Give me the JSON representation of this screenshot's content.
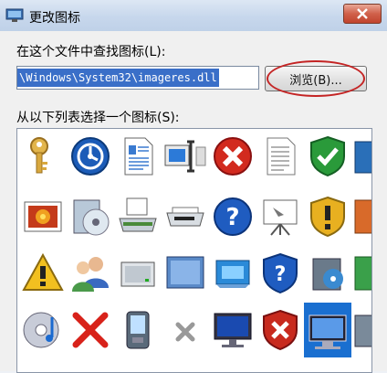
{
  "dialog": {
    "title": "更改图标"
  },
  "search_label": "在这个文件中查找图标(L):",
  "path_value": "\\Windows\\System32\\imageres.dll",
  "browse_label": "浏览(B)...",
  "list_label": "从以下列表选择一个图标(S):",
  "icons": [
    [
      "key-icon",
      "sync-center-icon",
      "document-icon",
      "display-adjust-icon",
      "error-icon",
      "text-document-icon",
      "security-shield-icon",
      "partial-icon"
    ],
    [
      "photo-gallery-icon",
      "media-icon",
      "scanner-icon",
      "printer-icon",
      "help-icon",
      "projector-screen-icon",
      "warning-shield-icon",
      "partial-icon"
    ],
    [
      "warning-icon",
      "users-icon",
      "drive-icon",
      "storage-panel-icon",
      "network-panel-icon",
      "help-shield-icon",
      "media-player-icon",
      "partial-icon"
    ],
    [
      "cd-music-icon",
      "red-x-icon",
      "pda-icon",
      "gray-x-icon",
      "monitor-icon",
      "denied-shield-icon",
      "screen-selected-icon",
      "partial-icon"
    ]
  ],
  "selected_icon": "screen-selected-icon"
}
